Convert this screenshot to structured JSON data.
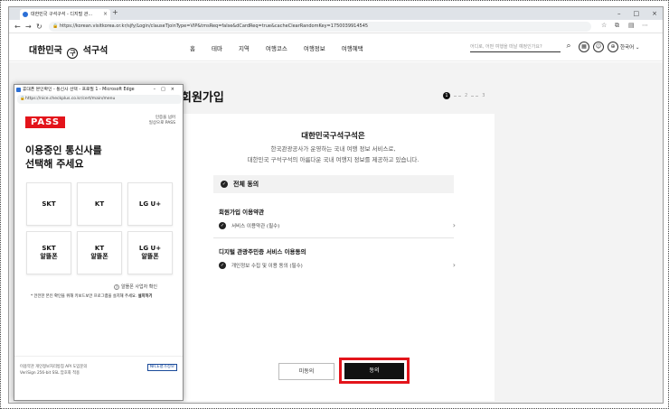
{
  "browser": {
    "tab_title": "대한민국 구석구석 - 디지털 관...",
    "url": "https://korean.visitkorea.or.kr/sjfy/Login/clauseTjoinType=VIP&tmsReq=false&dCardReq=true&cacheClearRandomKey=1750039914545"
  },
  "site": {
    "logo_left": "대한민국",
    "logo_emblem": "구",
    "logo_right": "석구석",
    "nav": [
      "홈",
      "테마",
      "지역",
      "여행코스",
      "여행정보",
      "여행혜택"
    ],
    "search_placeholder": "어디로, 어떤 여행을 떠날 예정인가요?",
    "lang": "한국어"
  },
  "page": {
    "title": "회원가입",
    "steps": [
      "1",
      "2",
      "3"
    ],
    "card_title": "대한민국구석구석은",
    "card_sub1": "한국관광공사가 운영하는 국내 여행 정보 서비스로,",
    "card_sub2": "대한민국 구석구석의 아름다운 국내 여행지 정보를 제공하고 있습니다.",
    "all_agree": "전체 동의",
    "section1": "회원가입 이용약관",
    "section1_item": "서비스 이용약관 (필수)",
    "section2": "디지털 관광주민증 서비스 이용동의",
    "section2_item": "개인정보 수집 및 이용 동의 (필수)",
    "disagree": "미동의",
    "agree": "동의"
  },
  "popup": {
    "window_title": "휴대폰 본인확인 - 통신사 선택 - 프로필 1 - Microsoft Edge",
    "url": "https://nice.checkplus.co.kr/cert/main/menu",
    "pass_logo": "PASS",
    "pass_tag_1": "인증을 넘어",
    "pass_tag_2": "일상으로 PASS",
    "heading_1": "이용중인 통신사를",
    "heading_2": "선택해 주세요",
    "carriers": [
      "SKT",
      "KT",
      "LG U+",
      "SKT\n알뜰폰",
      "KT\n알뜰폰",
      "LG U+\n알뜰폰"
    ],
    "budget_check": "알뜰폰 사업자 확인",
    "safe_note": "* 안전한 본인 확인을 위해 키보드보안 프로그램을 설치해 주세요.",
    "safe_note_link": "설치하기",
    "footer_1": "이용약관  개인정보처리방침  API 도입문의",
    "footer_2": "VeriSign 256-bit SSL 암호화 적용",
    "nice": "NICE평가정보"
  },
  "colors": {
    "accent": "#e3141b",
    "dark": "#111111"
  }
}
